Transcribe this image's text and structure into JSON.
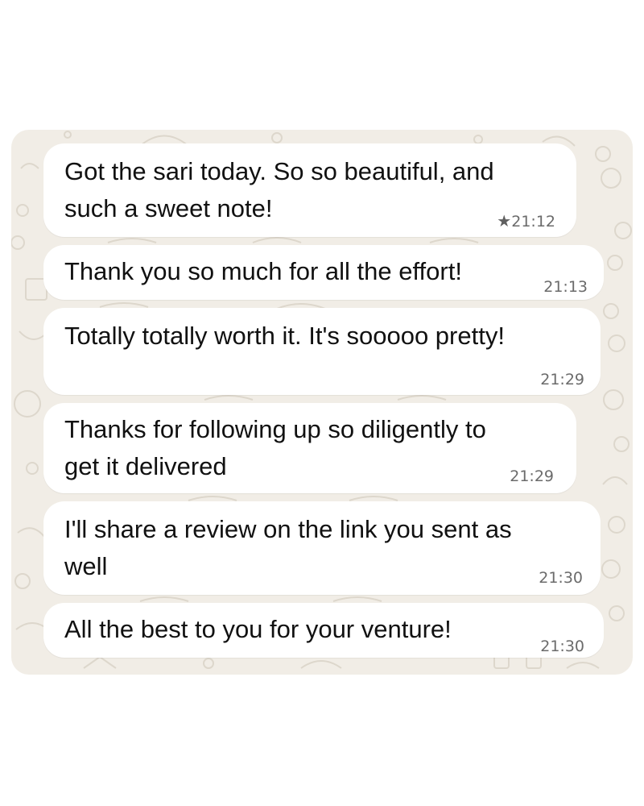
{
  "colors": {
    "wallpaper": "#f1ede6",
    "bubble": "#ffffff",
    "text": "#111111",
    "timestamp": "#6b6b6b"
  },
  "messages": [
    {
      "lines": [
        "Got the sari today. So so beautiful, and",
        "such a sweet note!"
      ],
      "time": "21:12",
      "starred": true,
      "star_icon": "star-icon"
    },
    {
      "lines": [
        "Thank you so much for all the effort!"
      ],
      "time": "21:13",
      "starred": false
    },
    {
      "lines": [
        "Totally totally worth it. It's sooooo pretty!"
      ],
      "time": "21:29",
      "starred": false
    },
    {
      "lines": [
        "Thanks for following up so diligently to",
        "get it delivered"
      ],
      "time": "21:29",
      "starred": false
    },
    {
      "lines": [
        "I'll share a review on the link you sent as",
        "well"
      ],
      "time": "21:30",
      "starred": false
    },
    {
      "lines": [
        "All the best to you for your venture!"
      ],
      "time": "21:30",
      "starred": false
    }
  ]
}
